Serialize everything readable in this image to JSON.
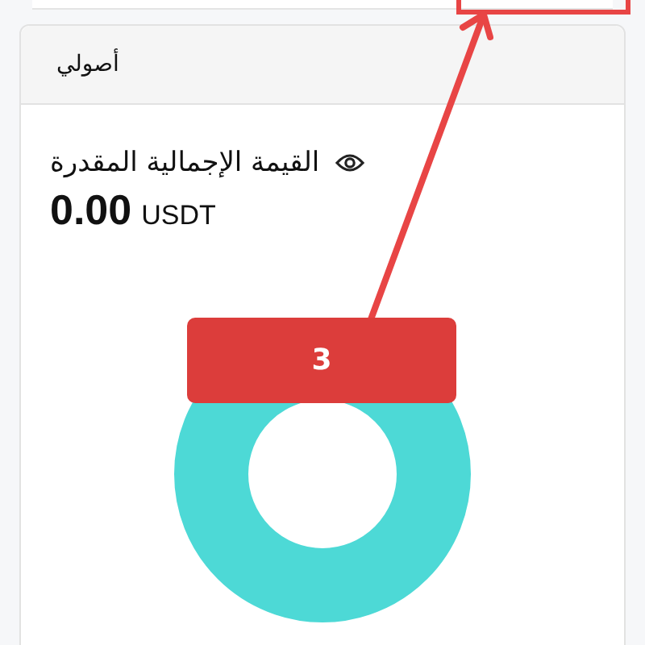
{
  "card": {
    "title": "أصولي",
    "total_label": "القيمة الإجمالية المقدرة",
    "amount": "0.00",
    "currency": "USDT"
  },
  "annotation": {
    "label": "3"
  }
}
